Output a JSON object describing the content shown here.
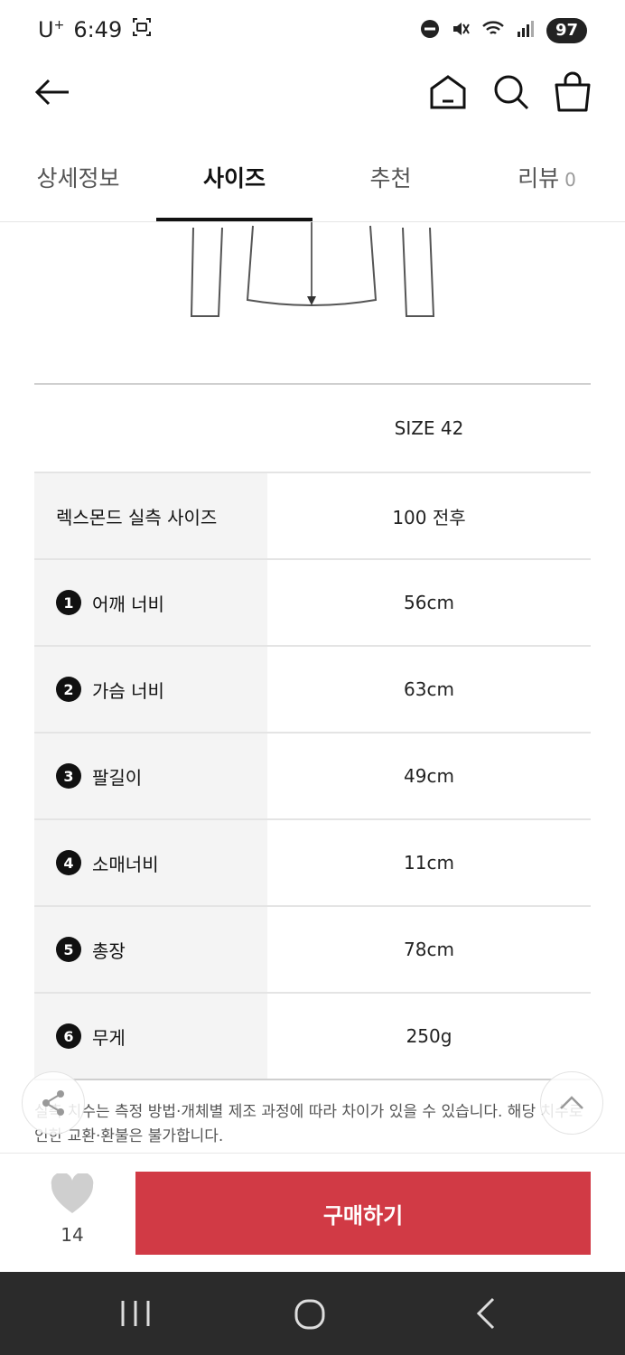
{
  "status_bar": {
    "carrier": "U",
    "carrier_sup": "+",
    "time": "6:49",
    "battery": "97"
  },
  "tabs": [
    {
      "label": "상세정보"
    },
    {
      "label": "사이즈"
    },
    {
      "label": "추천"
    },
    {
      "label": "리뷰",
      "count": "0"
    }
  ],
  "size_table": {
    "column_header": "SIZE 42",
    "rows": [
      {
        "label": "렉스몬드 실측 사이즈",
        "value": "100 전후"
      },
      {
        "num": "1",
        "label": "어깨 너비",
        "value": "56cm"
      },
      {
        "num": "2",
        "label": "가슴 너비",
        "value": "63cm"
      },
      {
        "num": "3",
        "label": "팔길이",
        "value": "49cm"
      },
      {
        "num": "4",
        "label": "소매너비",
        "value": "11cm"
      },
      {
        "num": "5",
        "label": "총장",
        "value": "78cm"
      },
      {
        "num": "6",
        "label": "무게",
        "value": "250g"
      }
    ]
  },
  "note": "실측 치수는 측정 방법·개체별 제조 과정에 따라 차이가 있을 수 있습니다. 해당 치수로 인한 교환·환불은 불가합니다.",
  "bottom_bar": {
    "like_count": "14",
    "buy_label": "구매하기"
  },
  "colors": {
    "buy_button": "#d13a45",
    "nav_bar": "#2b2b2b"
  }
}
